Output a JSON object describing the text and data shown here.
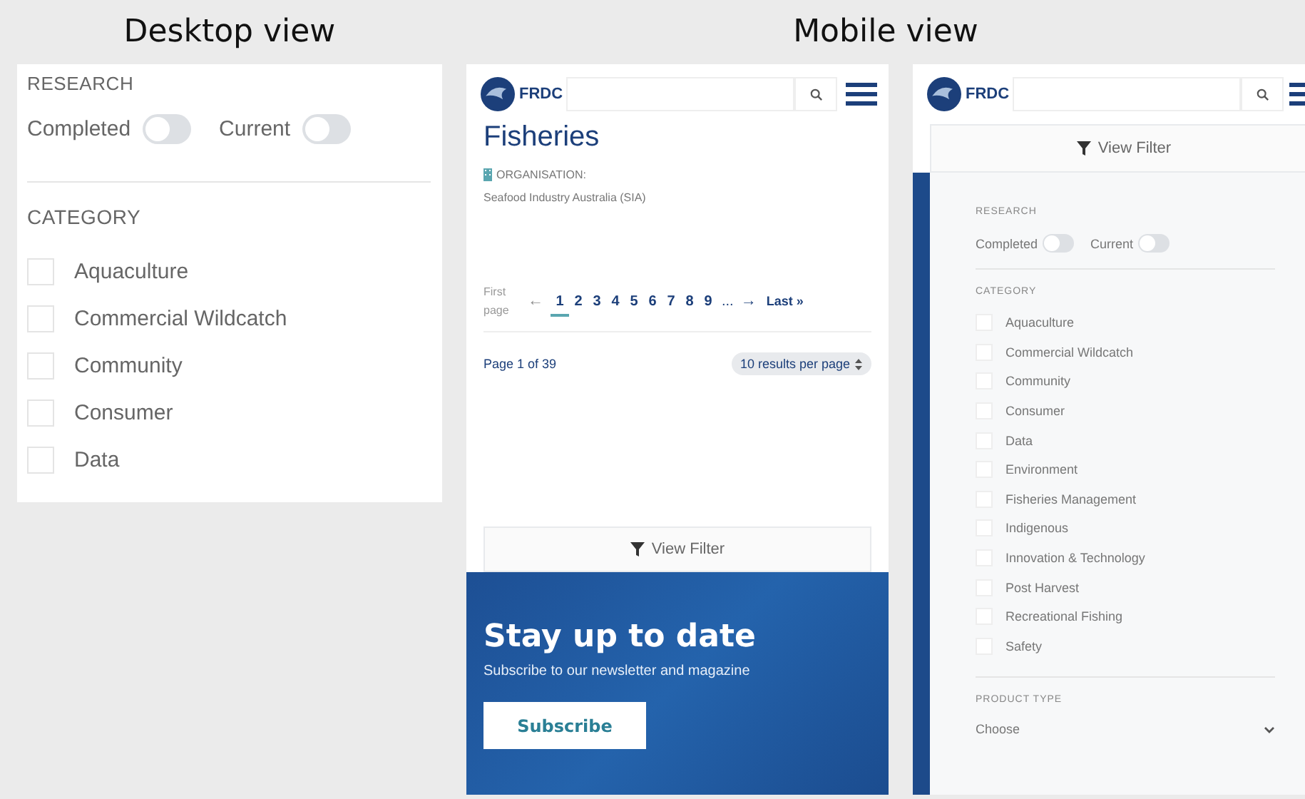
{
  "headings": [
    {
      "text": "Desktop view"
    },
    {
      "text": "Mobile view"
    }
  ],
  "desktop_filter": {
    "research_label": "RESEARCH",
    "toggles": [
      {
        "label": "Completed",
        "on": false
      },
      {
        "label": "Current",
        "on": false
      }
    ],
    "category_label": "CATEGORY",
    "categories": [
      {
        "label": "Aquaculture",
        "checked": false
      },
      {
        "label": "Commercial Wildcatch",
        "checked": false
      },
      {
        "label": "Community",
        "checked": false
      },
      {
        "label": "Consumer",
        "checked": false
      },
      {
        "label": "Data",
        "checked": false
      }
    ]
  },
  "mobile_results": {
    "logo": "FRDC",
    "title": "Fisheries",
    "organisation_label": "ORGANISATION:",
    "organisation": "Seafood Industry Australia (SIA)",
    "pagination": {
      "first": "First page",
      "prev": "←",
      "pages": [
        {
          "label": "1",
          "selected": true
        },
        {
          "label": "2",
          "selected": false
        },
        {
          "label": "3",
          "selected": false
        },
        {
          "label": "4",
          "selected": false
        },
        {
          "label": "5",
          "selected": false
        },
        {
          "label": "6",
          "selected": false
        },
        {
          "label": "7",
          "selected": false
        },
        {
          "label": "8",
          "selected": false
        },
        {
          "label": "9",
          "selected": false
        }
      ],
      "ellipsis": "...",
      "next": "→",
      "last": "Last »"
    },
    "page_info": "Page 1 of 39",
    "per_page": "10 results per page",
    "filter_button": "View Filter",
    "newsletter": {
      "title": "Stay up to date",
      "text": "Subscribe to our newsletter and magazine",
      "button": "Subscribe"
    }
  },
  "mobile_filter": {
    "logo": "FRDC",
    "filter_button": "View Filter",
    "research_label": "RESEARCH",
    "toggles": [
      {
        "label": "Completed",
        "on": false
      },
      {
        "label": "Current",
        "on": false
      }
    ],
    "category_label": "CATEGORY",
    "categories": [
      {
        "label": "Aquaculture",
        "checked": false
      },
      {
        "label": "Commercial Wildcatch",
        "checked": false
      },
      {
        "label": "Community",
        "checked": false
      },
      {
        "label": "Consumer",
        "checked": false
      },
      {
        "label": "Data",
        "checked": false
      },
      {
        "label": "Environment",
        "checked": false
      },
      {
        "label": "Fisheries Management",
        "checked": false
      },
      {
        "label": "Indigenous",
        "checked": false
      },
      {
        "label": "Innovation & Technology",
        "checked": false
      },
      {
        "label": "Post Harvest",
        "checked": false
      },
      {
        "label": "Recreational Fishing",
        "checked": false
      },
      {
        "label": "Safety",
        "checked": false
      }
    ],
    "product_type_label": "PRODUCT TYPE",
    "product_type_value": "Choose"
  }
}
